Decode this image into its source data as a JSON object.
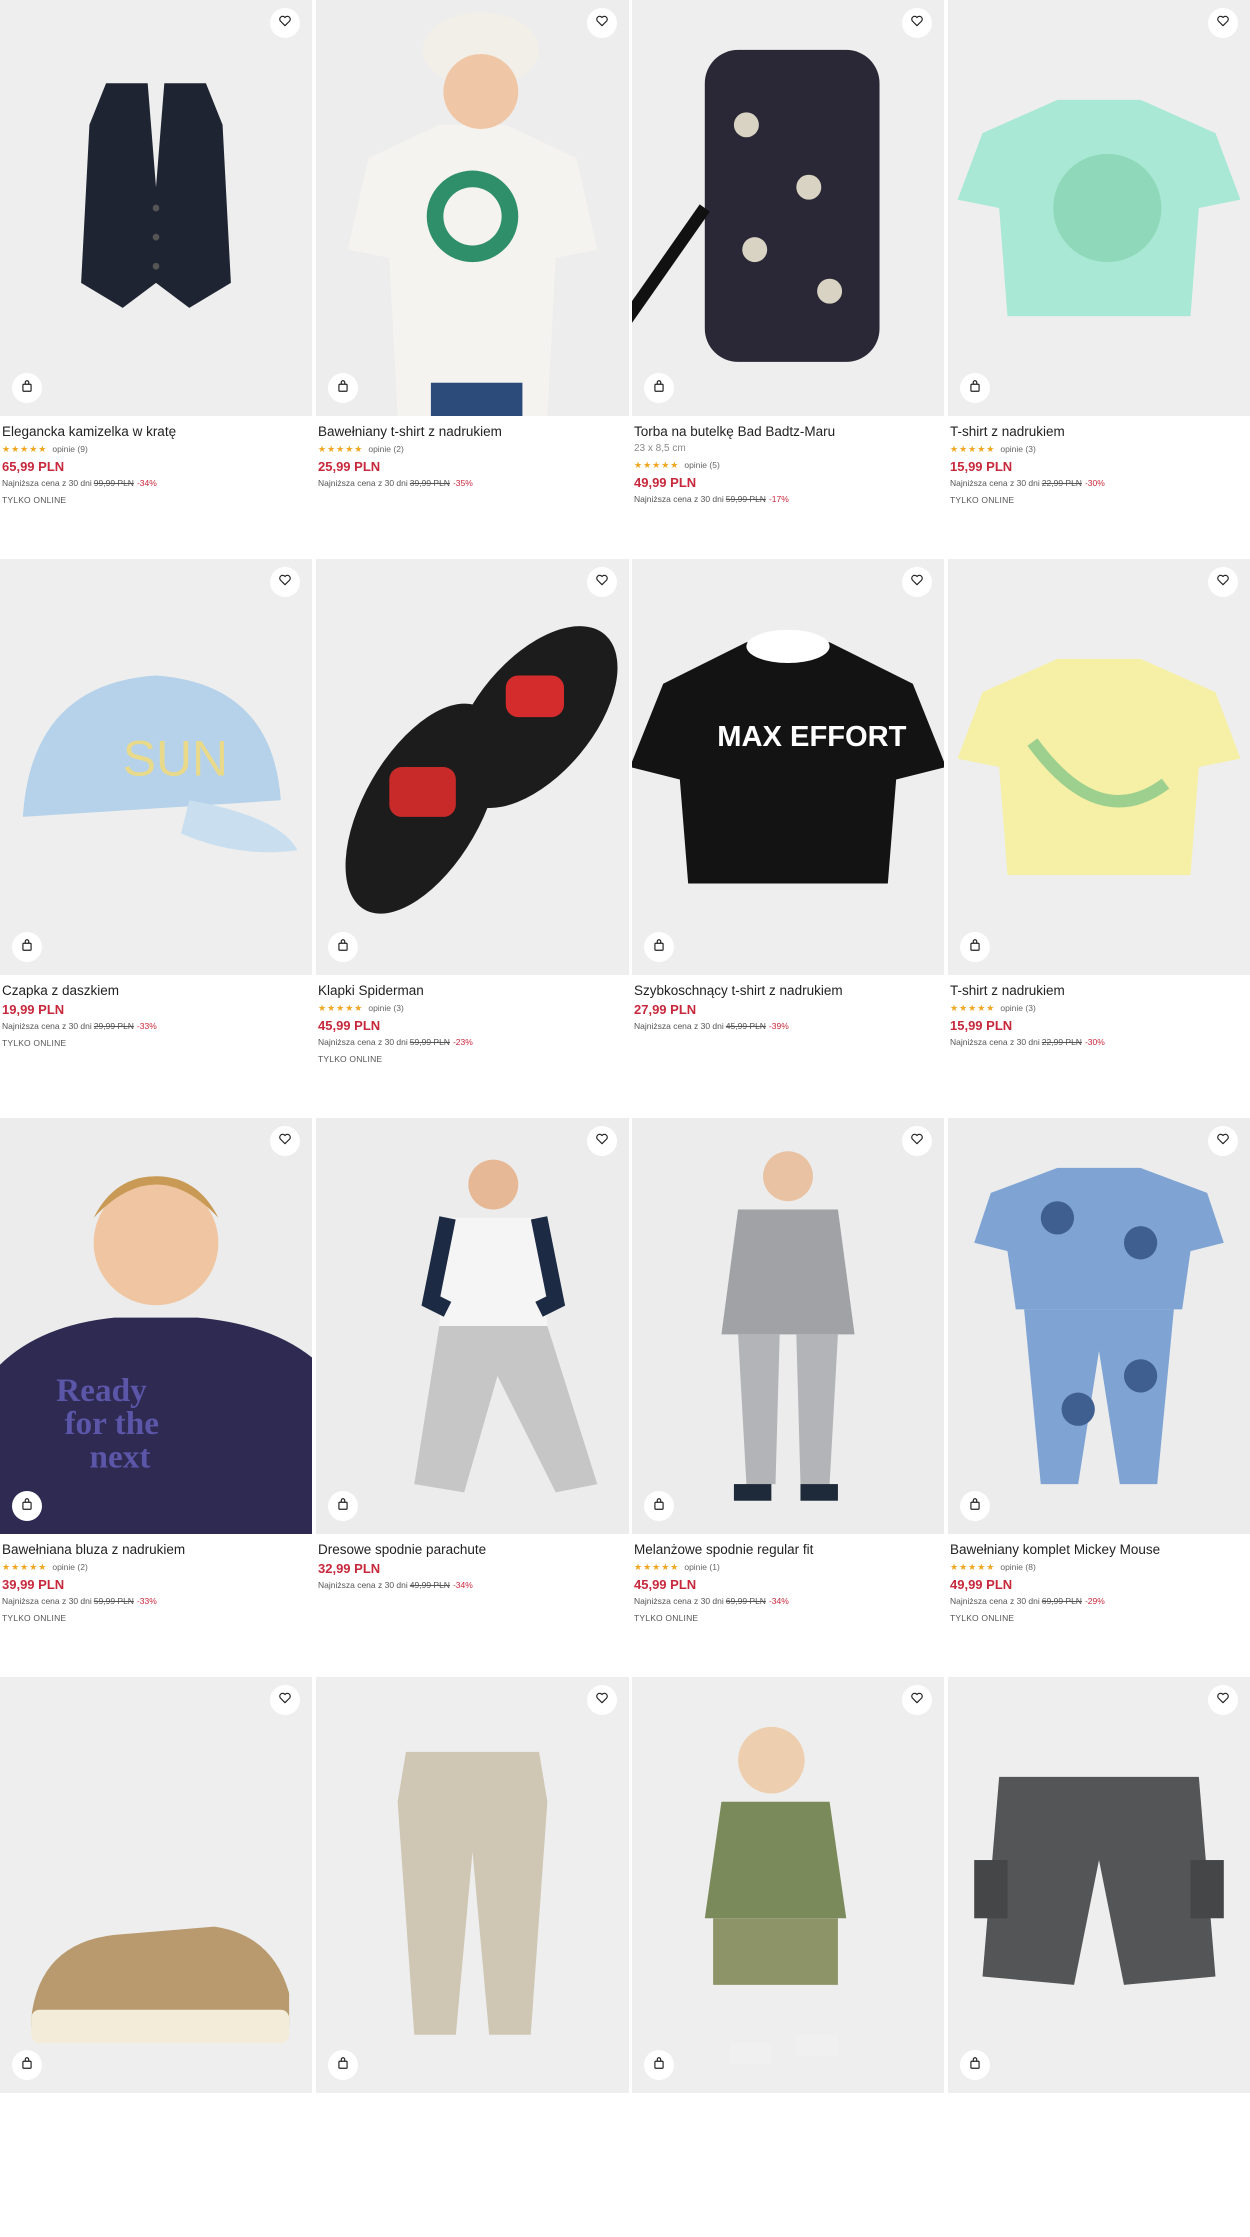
{
  "colors": {
    "price": "#c7283c",
    "star": "#f2a51f",
    "image_bg": "#ececec"
  },
  "icons": {
    "favorite": "heart-icon",
    "add_to_cart": "shopping-bag-icon"
  },
  "products": [
    {
      "name": "Elegancka kamizelka w kratę",
      "dims": "",
      "rating_stars": 5,
      "reviews": "opinie (9)",
      "price": "65,99 PLN",
      "lowest_label": "Najniższa cena z 30 dni",
      "old_price": "99,99 PLN",
      "discount": "-34%",
      "badge": "TYLKO ONLINE",
      "image": "vest"
    },
    {
      "name": "Bawełniany t-shirt z nadrukiem",
      "dims": "",
      "rating_stars": 5,
      "reviews": "opinie (2)",
      "price": "25,99 PLN",
      "lowest_label": "Najniższa cena z 30 dni",
      "old_price": "39,99 PLN",
      "discount": "-35%",
      "badge": "",
      "image": "kid-tshirt"
    },
    {
      "name": "Torba na butelkę Bad Badtz-Maru",
      "dims": "23 x 8,5 cm",
      "rating_stars": 5,
      "reviews": "opinie (5)",
      "price": "49,99 PLN",
      "lowest_label": "Najniższa cena z 30 dni",
      "old_price": "59,99 PLN",
      "discount": "-17%",
      "badge": "",
      "image": "bottle-bag"
    },
    {
      "name": "T-shirt z nadrukiem",
      "dims": "",
      "rating_stars": 5,
      "reviews": "opinie (3)",
      "price": "15,99 PLN",
      "lowest_label": "Najniższa cena z 30 dni",
      "old_price": "22,99 PLN",
      "discount": "-30%",
      "badge": "TYLKO ONLINE",
      "image": "mint-tee"
    },
    {
      "name": "Czapka z daszkiem",
      "dims": "",
      "rating_stars": 0,
      "reviews": "",
      "price": "19,99 PLN",
      "lowest_label": "Najniższa cena z 30 dni",
      "old_price": "29,99 PLN",
      "discount": "-33%",
      "badge": "TYLKO ONLINE",
      "image": "cap"
    },
    {
      "name": "Klapki Spiderman",
      "dims": "",
      "rating_stars": 5,
      "reviews": "opinie (3)",
      "price": "45,99 PLN",
      "lowest_label": "Najniższa cena z 30 dni",
      "old_price": "59,99 PLN",
      "discount": "-23%",
      "badge": "TYLKO ONLINE",
      "image": "slides"
    },
    {
      "name": "Szybkoschnący t-shirt z nadrukiem",
      "dims": "",
      "rating_stars": 0,
      "reviews": "",
      "price": "27,99 PLN",
      "lowest_label": "Najniższa cena z 30 dni",
      "old_price": "45,99 PLN",
      "discount": "-39%",
      "badge": "",
      "image": "black-tee"
    },
    {
      "name": "T-shirt z nadrukiem",
      "dims": "",
      "rating_stars": 5,
      "reviews": "opinie (3)",
      "price": "15,99 PLN",
      "lowest_label": "Najniższa cena z 30 dni",
      "old_price": "22,99 PLN",
      "discount": "-30%",
      "badge": "",
      "image": "yellow-tee"
    },
    {
      "name": "Bawełniana bluza z nadrukiem",
      "dims": "",
      "rating_stars": 4.5,
      "reviews": "opinie (2)",
      "price": "39,99 PLN",
      "lowest_label": "Najniższa cena z 30 dni",
      "old_price": "59,99 PLN",
      "discount": "-33%",
      "badge": "TYLKO ONLINE",
      "image": "sweatshirt"
    },
    {
      "name": "Dresowe spodnie parachute",
      "dims": "",
      "rating_stars": 0,
      "reviews": "",
      "price": "32,99 PLN",
      "lowest_label": "Najniższa cena z 30 dni",
      "old_price": "49,99 PLN",
      "discount": "-34%",
      "badge": "",
      "image": "parachute"
    },
    {
      "name": "Melanżowe spodnie regular fit",
      "dims": "",
      "rating_stars": 5,
      "reviews": "opinie (1)",
      "price": "45,99 PLN",
      "lowest_label": "Najniższa cena z 30 dni",
      "old_price": "69,99 PLN",
      "discount": "-34%",
      "badge": "TYLKO ONLINE",
      "image": "suit"
    },
    {
      "name": "Bawełniany komplet Mickey Mouse",
      "dims": "",
      "rating_stars": 4.5,
      "reviews": "opinie (8)",
      "price": "49,99 PLN",
      "lowest_label": "Najniższa cena z 30 dni",
      "old_price": "69,99 PLN",
      "discount": "-29%",
      "badge": "TYLKO ONLINE",
      "image": "mickey-set"
    },
    {
      "name": "",
      "dims": "",
      "rating_stars": 0,
      "reviews": "",
      "price": "",
      "lowest_label": "",
      "old_price": "",
      "discount": "",
      "badge": "",
      "image": "sneaker"
    },
    {
      "name": "",
      "dims": "",
      "rating_stars": 0,
      "reviews": "",
      "price": "",
      "lowest_label": "",
      "old_price": "",
      "discount": "",
      "badge": "",
      "image": "beige-joggers"
    },
    {
      "name": "",
      "dims": "",
      "rating_stars": 0,
      "reviews": "",
      "price": "",
      "lowest_label": "",
      "old_price": "",
      "discount": "",
      "badge": "",
      "image": "khaki-set"
    },
    {
      "name": "",
      "dims": "",
      "rating_stars": 0,
      "reviews": "",
      "price": "",
      "lowest_label": "",
      "old_price": "",
      "discount": "",
      "badge": "",
      "image": "denim-shorts"
    }
  ]
}
